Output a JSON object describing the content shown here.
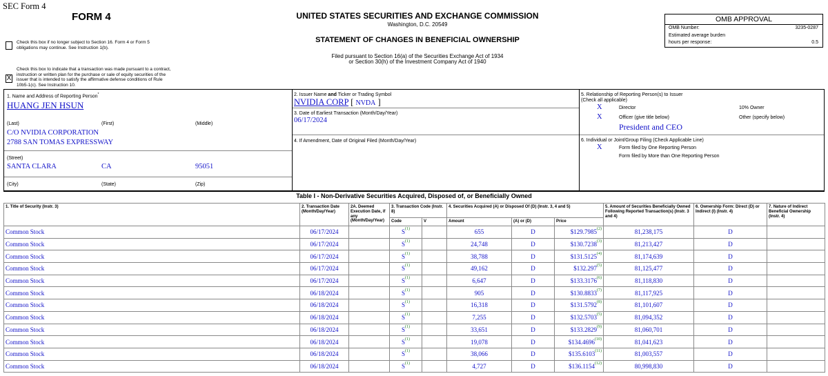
{
  "doc_title": "SEC Form 4",
  "form_name": "FORM 4",
  "commission": "UNITED STATES SECURITIES AND EXCHANGE COMMISSION",
  "commission_city": "Washington, D.C. 20549",
  "statement_title": "STATEMENT OF CHANGES IN BENEFICIAL OWNERSHIP",
  "filed_line1": "Filed pursuant to Section 16(a) of the Securities Exchange Act of 1934",
  "filed_line2": "or Section 30(h) of the Investment Company Act of 1940",
  "omb": {
    "heading": "OMB APPROVAL",
    "number_label": "OMB Number:",
    "number_value": "3235-0287",
    "burden_label": "Estimated average burden",
    "hours_label": "hours per response:",
    "hours_value": "0.5"
  },
  "checkbox1": {
    "mark": "",
    "text": "Check this box if no longer subject to Section 16. Form 4 or Form 5 obligations may continue. See Instruction 1(b)."
  },
  "checkbox2": {
    "mark": "X",
    "text": "Check this box to indicate that a transaction was made pursuant to a contract, instruction or written plan for the purchase or sale of equity securities of the issuer that is intended to satisfy the affirmative defense conditions of Rule 10b5-1(c). See Instruction 10."
  },
  "box1": {
    "label": "1. Name and Address of Reporting Person",
    "asterisk": "*",
    "name": "HUANG JEN HSUN",
    "last_label": "(Last)",
    "first_label": "(First)",
    "middle_label": "(Middle)",
    "address1": "C/O NVIDIA CORPORATION",
    "address2": "2788 SAN TOMAS EXPRESSWAY",
    "street_label": "(Street)",
    "city": "SANTA CLARA",
    "state": "CA",
    "zip": "95051",
    "city_label": "(City)",
    "state_label": "(State)",
    "zip_label": "(Zip)"
  },
  "box2": {
    "label_pre": "2. Issuer Name ",
    "label_and": "and",
    "label_post": " Ticker or Trading Symbol",
    "issuer": "NVIDIA CORP",
    "bracket_open": "[",
    "ticker": "NVDA",
    "bracket_close": "]"
  },
  "box3": {
    "label": "3. Date of Earliest Transaction (Month/Day/Year)",
    "date": "06/17/2024"
  },
  "box4": {
    "label": "4. If Amendment, Date of Original Filed (Month/Day/Year)"
  },
  "box5": {
    "label1": "5. Relationship of Reporting Person(s) to Issuer",
    "label2": "(Check all applicable)",
    "director_mark": "X",
    "director_label": "Director",
    "tenpct_label": "10% Owner",
    "officer_mark": "X",
    "officer_label": "Officer (give title below)",
    "other_label": "Other (specify below)",
    "officer_title": "President and CEO"
  },
  "box6": {
    "label": "6. Individual or Joint/Group Filing (Check Applicable Line)",
    "one_mark": "X",
    "one_label": "Form filed by One Reporting Person",
    "more_label": "Form filed by More than One Reporting Person"
  },
  "table1": {
    "title": "Table I - Non-Derivative Securities Acquired, Disposed of, or Beneficially Owned",
    "headers": {
      "title_security": "1. Title of Security (Instr. 3)",
      "trans_date": "2. Transaction Date (Month/Day/Year)",
      "deemed_date": "2A. Deemed Execution Date, if any (Month/Day/Year)",
      "trans_code": "3. Transaction Code (Instr. 8)",
      "securities": "4. Securities Acquired (A) or Disposed Of (D) (Instr. 3, 4 and 5)",
      "amount_owned": "5. Amount of Securities Beneficially Owned Following Reported Transaction(s) (Instr. 3 and 4)",
      "ownership_form": "6. Ownership Form: Direct (D) or Indirect (I) (Instr. 4)",
      "nature": "7. Nature of Indirect Beneficial Ownership (Instr. 4)",
      "code": "Code",
      "v": "V",
      "amount": "Amount",
      "a_or_d": "(A) or (D)",
      "price": "Price"
    },
    "rows": [
      {
        "title": "Common Stock",
        "date": "06/17/2024",
        "code": "S",
        "code_fn": "(1)",
        "amount": "655",
        "ad": "D",
        "price": "$129.7985",
        "price_fn": "(2)",
        "owned": "81,238,175",
        "form": "D"
      },
      {
        "title": "Common Stock",
        "date": "06/17/2024",
        "code": "S",
        "code_fn": "(1)",
        "amount": "24,748",
        "ad": "D",
        "price": "$130.7238",
        "price_fn": "(3)",
        "owned": "81,213,427",
        "form": "D"
      },
      {
        "title": "Common Stock",
        "date": "06/17/2024",
        "code": "S",
        "code_fn": "(1)",
        "amount": "38,788",
        "ad": "D",
        "price": "$131.5125",
        "price_fn": "(4)",
        "owned": "81,174,639",
        "form": "D"
      },
      {
        "title": "Common Stock",
        "date": "06/17/2024",
        "code": "S",
        "code_fn": "(1)",
        "amount": "49,162",
        "ad": "D",
        "price": "$132.297",
        "price_fn": "(5)",
        "owned": "81,125,477",
        "form": "D"
      },
      {
        "title": "Common Stock",
        "date": "06/17/2024",
        "code": "S",
        "code_fn": "(1)",
        "amount": "6,647",
        "ad": "D",
        "price": "$133.3176",
        "price_fn": "(6)",
        "owned": "81,118,830",
        "form": "D"
      },
      {
        "title": "Common Stock",
        "date": "06/18/2024",
        "code": "S",
        "code_fn": "(1)",
        "amount": "905",
        "ad": "D",
        "price": "$130.8833",
        "price_fn": "(7)",
        "owned": "81,117,925",
        "form": "D"
      },
      {
        "title": "Common Stock",
        "date": "06/18/2024",
        "code": "S",
        "code_fn": "(1)",
        "amount": "16,318",
        "ad": "D",
        "price": "$131.5792",
        "price_fn": "(8)",
        "owned": "81,101,607",
        "form": "D"
      },
      {
        "title": "Common Stock",
        "date": "06/18/2024",
        "code": "S",
        "code_fn": "(1)",
        "amount": "7,255",
        "ad": "D",
        "price": "$132.5703",
        "price_fn": "(5)",
        "owned": "81,094,352",
        "form": "D"
      },
      {
        "title": "Common Stock",
        "date": "06/18/2024",
        "code": "S",
        "code_fn": "(1)",
        "amount": "33,651",
        "ad": "D",
        "price": "$133.2829",
        "price_fn": "(9)",
        "owned": "81,060,701",
        "form": "D"
      },
      {
        "title": "Common Stock",
        "date": "06/18/2024",
        "code": "S",
        "code_fn": "(1)",
        "amount": "19,078",
        "ad": "D",
        "price": "$134.4696",
        "price_fn": "(10)",
        "owned": "81,041,623",
        "form": "D"
      },
      {
        "title": "Common Stock",
        "date": "06/18/2024",
        "code": "S",
        "code_fn": "(1)",
        "amount": "38,066",
        "ad": "D",
        "price": "$135.6103",
        "price_fn": "(11)",
        "owned": "81,003,557",
        "form": "D"
      },
      {
        "title": "Common Stock",
        "date": "06/18/2024",
        "code": "S",
        "code_fn": "(1)",
        "amount": "4,727",
        "ad": "D",
        "price": "$136.1154",
        "price_fn": "(12)",
        "owned": "80,998,830",
        "form": "D"
      }
    ]
  }
}
